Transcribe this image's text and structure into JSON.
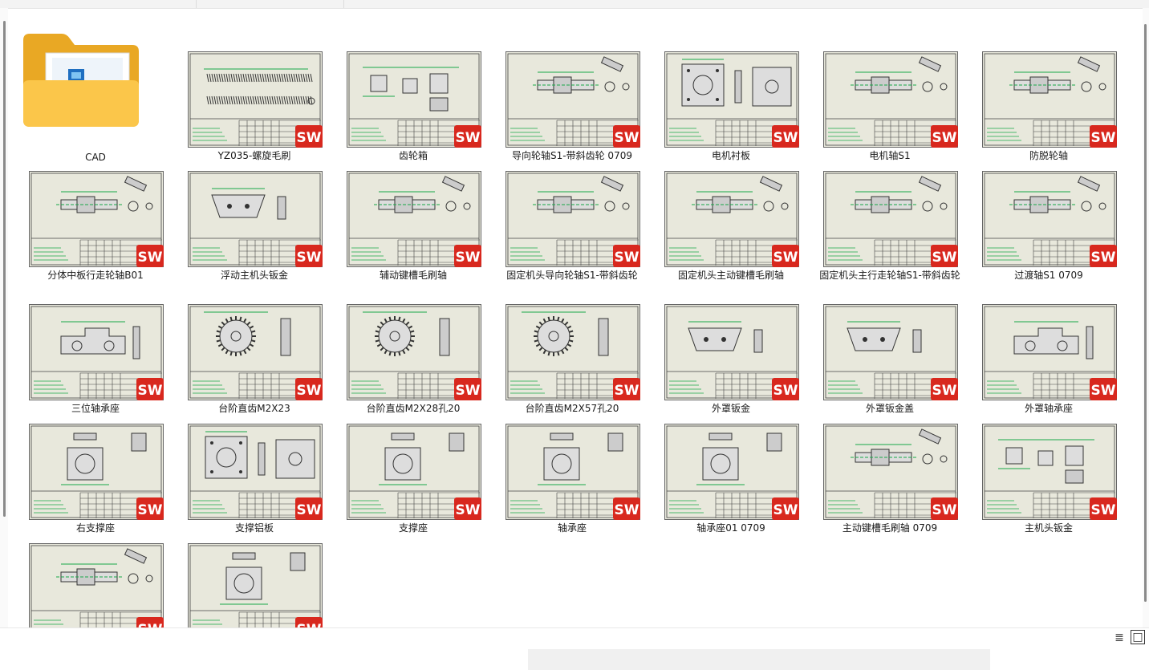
{
  "folder": {
    "label": "CAD"
  },
  "files": [
    {
      "label": "YZ035-螺旋毛刷",
      "badge": "SW",
      "drawing": "spring"
    },
    {
      "label": "齿轮箱",
      "badge": "SW",
      "drawing": "box"
    },
    {
      "label": "导向轮轴S1-带斜齿轮  0709",
      "badge": "SW",
      "drawing": "shaft"
    },
    {
      "label": "电机衬板",
      "badge": "SW",
      "drawing": "plate"
    },
    {
      "label": "电机轴S1",
      "badge": "SW",
      "drawing": "shaft"
    },
    {
      "label": "防脱轮轴",
      "badge": "SW",
      "drawing": "shaft"
    },
    {
      "label": "分体中板行走轮轴B01",
      "badge": "SW",
      "drawing": "shaft"
    },
    {
      "label": "浮动主机头钣金",
      "badge": "SW",
      "drawing": "trapezoid"
    },
    {
      "label": "辅动键槽毛刷轴",
      "badge": "SW",
      "drawing": "shaft"
    },
    {
      "label": "固定机头导向轮轴S1-带斜齿轮",
      "badge": "SW",
      "drawing": "shaft"
    },
    {
      "label": "固定机头主动键槽毛刷轴",
      "badge": "SW",
      "drawing": "shaft"
    },
    {
      "label": "固定机头主行走轮轴S1-带斜齿轮",
      "badge": "SW",
      "drawing": "shaft"
    },
    {
      "label": "过渡轴S1 0709",
      "badge": "SW",
      "drawing": "shaft"
    },
    {
      "label": "三位轴承座",
      "badge": "SW",
      "drawing": "bearing"
    },
    {
      "label": "台阶直齿M2X23",
      "badge": "SW",
      "drawing": "gear"
    },
    {
      "label": "台阶直齿M2X28孔20",
      "badge": "SW",
      "drawing": "gear"
    },
    {
      "label": "台阶直齿M2X57孔20",
      "badge": "SW",
      "drawing": "gear"
    },
    {
      "label": "外罩钣金",
      "badge": "SW",
      "drawing": "trapezoid"
    },
    {
      "label": "外罩钣金盖",
      "badge": "SW",
      "drawing": "trapezoid"
    },
    {
      "label": "外罩轴承座",
      "badge": "SW",
      "drawing": "bearing"
    },
    {
      "label": "右支撑座",
      "badge": "SW",
      "drawing": "block"
    },
    {
      "label": "支撑铝板",
      "badge": "SW",
      "drawing": "plate"
    },
    {
      "label": "支撑座",
      "badge": "SW",
      "drawing": "block"
    },
    {
      "label": "轴承座",
      "badge": "SW",
      "drawing": "block"
    },
    {
      "label": "轴承座01  0709",
      "badge": "SW",
      "drawing": "block"
    },
    {
      "label": "主动键槽毛刷轴  0709",
      "badge": "SW",
      "drawing": "shaft"
    },
    {
      "label": "主机头钣金",
      "badge": "SW",
      "drawing": "box"
    },
    {
      "label": "",
      "badge": "SW",
      "drawing": "shaft"
    },
    {
      "label": "",
      "badge": "SW",
      "drawing": "block"
    }
  ],
  "colors": {
    "sheet": "#e8e8dc",
    "badge_red": "#d8281e",
    "line_green": "#18a848"
  },
  "view": {
    "details_icon": "details-view-icon",
    "icons_icon": "large-icons-view-icon",
    "details_glyph": "≣",
    "icons_glyph": "□"
  }
}
